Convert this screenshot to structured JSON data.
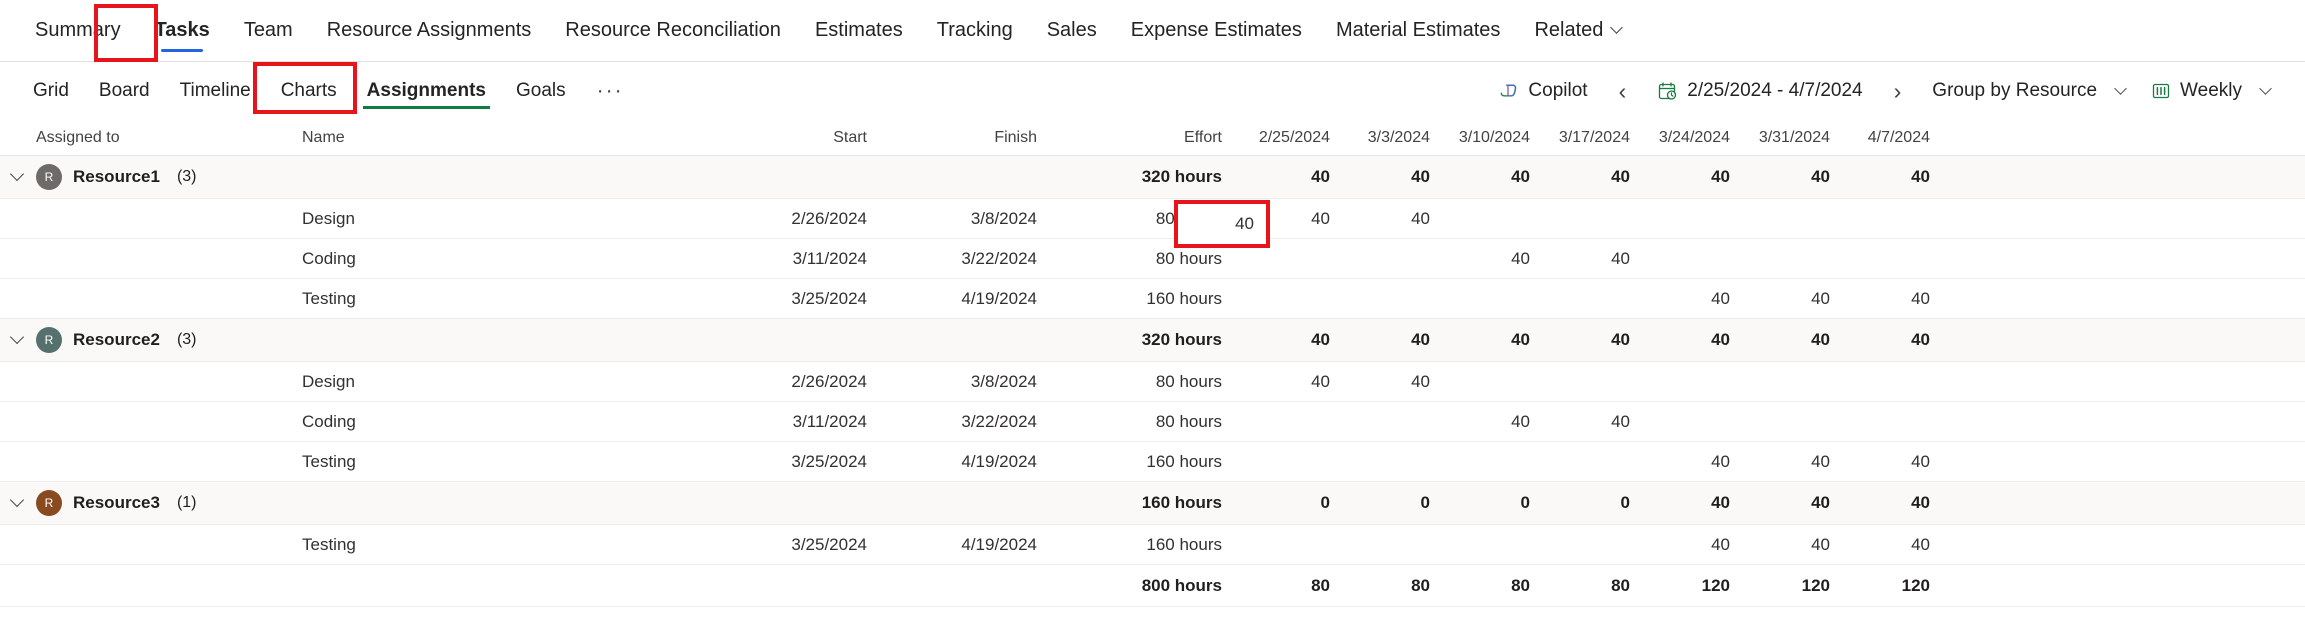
{
  "topnav": {
    "items": [
      {
        "label": "Summary",
        "selected": false
      },
      {
        "label": "Tasks",
        "selected": true
      },
      {
        "label": "Team",
        "selected": false
      },
      {
        "label": "Resource Assignments",
        "selected": false
      },
      {
        "label": "Resource Reconciliation",
        "selected": false
      },
      {
        "label": "Estimates",
        "selected": false
      },
      {
        "label": "Tracking",
        "selected": false
      },
      {
        "label": "Sales",
        "selected": false
      },
      {
        "label": "Expense Estimates",
        "selected": false
      },
      {
        "label": "Material Estimates",
        "selected": false
      },
      {
        "label": "Related",
        "selected": false,
        "dropdown": true
      }
    ]
  },
  "subbar": {
    "items": [
      {
        "label": "Grid",
        "selected": false
      },
      {
        "label": "Board",
        "selected": false
      },
      {
        "label": "Timeline",
        "selected": false
      },
      {
        "label": "Charts",
        "selected": false
      },
      {
        "label": "Assignments",
        "selected": true
      },
      {
        "label": "Goals",
        "selected": false
      }
    ],
    "overflow_label": "···",
    "copilot_label": "Copilot",
    "prev_label": "‹",
    "next_label": "›",
    "date_range": "2/25/2024 - 4/7/2024",
    "group_by_label": "Group by Resource",
    "view_scale_label": "Weekly"
  },
  "table": {
    "headers": {
      "assigned_to": "Assigned to",
      "name": "Name",
      "start": "Start",
      "finish": "Finish",
      "effort": "Effort",
      "dates": [
        "2/25/2024",
        "3/3/2024",
        "3/10/2024",
        "3/17/2024",
        "3/24/2024",
        "3/31/2024",
        "4/7/2024"
      ]
    },
    "groups": [
      {
        "name": "Resource1",
        "count": "(3)",
        "avatar_initial": "R",
        "avatar_color": "#6d6a67",
        "effort": "320 hours",
        "values": [
          "40",
          "40",
          "40",
          "40",
          "40",
          "40",
          "40"
        ],
        "rows": [
          {
            "name": "Design",
            "start": "2/26/2024",
            "finish": "3/8/2024",
            "effort": "80 hours",
            "values": [
              "40",
              "40",
              "",
              "",
              "",
              "",
              ""
            ]
          },
          {
            "name": "Coding",
            "start": "3/11/2024",
            "finish": "3/22/2024",
            "effort": "80 hours",
            "values": [
              "",
              "",
              "40",
              "40",
              "",
              "",
              ""
            ]
          },
          {
            "name": "Testing",
            "start": "3/25/2024",
            "finish": "4/19/2024",
            "effort": "160 hours",
            "values": [
              "",
              "",
              "",
              "",
              "40",
              "40",
              "40"
            ]
          }
        ]
      },
      {
        "name": "Resource2",
        "count": "(3)",
        "avatar_initial": "R",
        "avatar_color": "#56706d",
        "effort": "320 hours",
        "values": [
          "40",
          "40",
          "40",
          "40",
          "40",
          "40",
          "40"
        ],
        "rows": [
          {
            "name": "Design",
            "start": "2/26/2024",
            "finish": "3/8/2024",
            "effort": "80 hours",
            "values": [
              "40",
              "40",
              "",
              "",
              "",
              "",
              ""
            ]
          },
          {
            "name": "Coding",
            "start": "3/11/2024",
            "finish": "3/22/2024",
            "effort": "80 hours",
            "values": [
              "",
              "",
              "40",
              "40",
              "",
              "",
              ""
            ]
          },
          {
            "name": "Testing",
            "start": "3/25/2024",
            "finish": "4/19/2024",
            "effort": "160 hours",
            "values": [
              "",
              "",
              "",
              "",
              "40",
              "40",
              "40"
            ]
          }
        ]
      },
      {
        "name": "Resource3",
        "count": "(1)",
        "avatar_initial": "R",
        "avatar_color": "#8a4a20",
        "effort": "160 hours",
        "values": [
          "0",
          "0",
          "0",
          "0",
          "40",
          "40",
          "40"
        ],
        "rows": [
          {
            "name": "Testing",
            "start": "3/25/2024",
            "finish": "4/19/2024",
            "effort": "160 hours",
            "values": [
              "",
              "",
              "",
              "",
              "40",
              "40",
              "40"
            ]
          }
        ]
      }
    ],
    "total": {
      "effort": "800 hours",
      "values": [
        "80",
        "80",
        "80",
        "80",
        "120",
        "120",
        "120"
      ]
    }
  },
  "highlights": {
    "selected_cell_value": "40"
  },
  "colors": {
    "tab_accent": "#2266dd",
    "subtab_accent": "#107c41",
    "highlight_border": "#e8141b",
    "group_row_bg": "#faf9f8"
  }
}
